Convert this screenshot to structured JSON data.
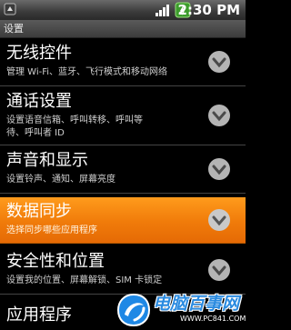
{
  "status_bar": {
    "time": "2:30 PM",
    "icons": [
      "notification-icon",
      "signal-icon",
      "battery-icon"
    ]
  },
  "title_bar": {
    "title": "设置"
  },
  "settings": [
    {
      "title": "无线控件",
      "subtitle": "管理 Wi-Fi、蓝牙、飞行模式和移动网络",
      "highlighted": false
    },
    {
      "title": "通话设置",
      "subtitle": "设置语音信箱、呼叫转移、呼叫等待、呼叫者 ID",
      "subtitle_lines": [
        "设置语音信箱、呼叫转移、呼叫等",
        "待、呼叫者 ID"
      ],
      "highlighted": false
    },
    {
      "title": "声音和显示",
      "subtitle": "设置铃声、通知、屏幕亮度",
      "highlighted": false
    },
    {
      "title": "数据同步",
      "subtitle": "选择同步哪些应用程序",
      "highlighted": true
    },
    {
      "title": "安全性和位置",
      "subtitle": "设置我的位置、屏幕解锁、SIM 卡锁定",
      "highlighted": false
    },
    {
      "title": "应用程序",
      "highlighted": false
    }
  ],
  "watermark": {
    "name": "电脑百事网",
    "url": "WWW.PC841.COM"
  },
  "colors": {
    "highlight": "#f08010",
    "background": "#000000",
    "chevron": "#b0b0b0"
  }
}
